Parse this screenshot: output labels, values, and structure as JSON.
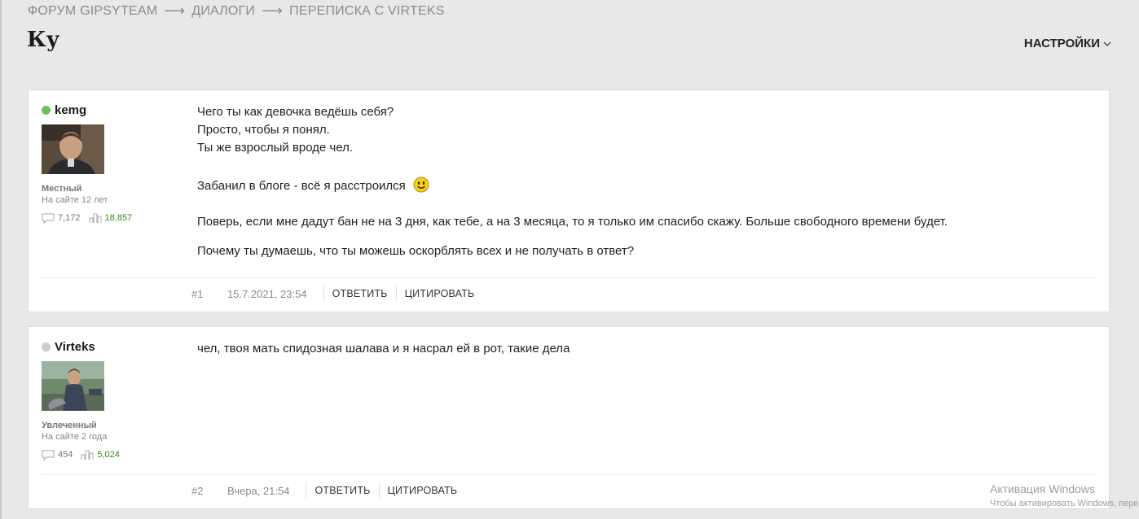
{
  "breadcrumb": {
    "items": [
      "ФОРУМ GIPSYTEAM",
      "ДИАЛОГИ",
      "ПЕРЕПИСКА С VIRTEKS"
    ],
    "separator": "⟶"
  },
  "page": {
    "title": "Ку",
    "settings_label": "НАСТРОЙКИ"
  },
  "posts": [
    {
      "username": "kemg",
      "online": true,
      "status_color": "#6cc25a",
      "rank": "Местный",
      "since": "На сайте 12 лет",
      "messages": "7,172",
      "likes": "18,857",
      "lines": [
        "Чего ты как девочка ведёшь себя?",
        "Просто, чтобы я понял.",
        "Ты же взрослый вроде чел.",
        "",
        "Забанил в блоге - всё я расстроился",
        "",
        "Поверь, если мне дадут бан не на 3 дня, как тебе, а на 3 месяца, то я только им спасибо скажу. Больше свободного времени будет.",
        "",
        "Почему ты думаешь, что ты можешь оскорблять всех и не получать в ответ?"
      ],
      "number": "#1",
      "date": "15.7.2021, 23:54",
      "reply_label": "ОТВЕТИТЬ",
      "quote_label": "ЦИТИРОВАТЬ"
    },
    {
      "username": "Virteks",
      "online": false,
      "status_color": "#cccccc",
      "rank": "Увлеченный",
      "since": "На сайте 2 года",
      "messages": "454",
      "likes": "5,024",
      "lines": [
        "чел, твоя мать спидозная шалава и я насрал ей в рот, такие дела"
      ],
      "number": "#2",
      "date": "Вчера, 21:54",
      "reply_label": "ОТВЕТИТЬ",
      "quote_label": "ЦИТИРОВАТЬ"
    }
  ],
  "watermark": {
    "line1": "Активация Windows",
    "line2": "Чтобы активировать Windows, пере"
  }
}
